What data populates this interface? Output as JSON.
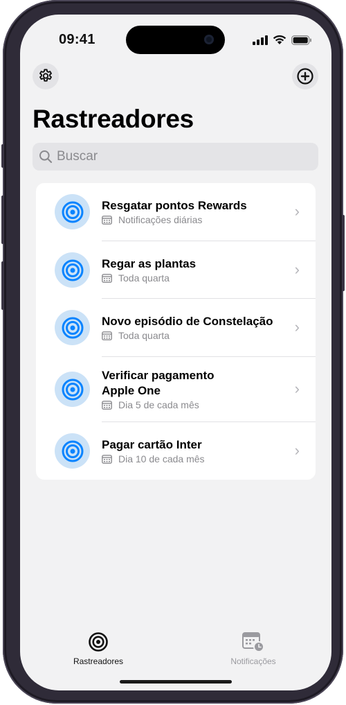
{
  "status_bar": {
    "time": "09:41"
  },
  "header": {
    "title": "Rastreadores"
  },
  "search": {
    "placeholder": "Buscar"
  },
  "colors": {
    "accent": "#0a84ff",
    "icon_bg": "#cbe2f7",
    "secondary_text": "#8a8a8e"
  },
  "trackers": [
    {
      "name": "Resgatar pontos Rewards",
      "schedule": "Notificações diárias"
    },
    {
      "name": "Regar as plantas",
      "schedule": "Toda quarta"
    },
    {
      "name": "Novo episódio de Constelação",
      "schedule": "Toda quarta"
    },
    {
      "name": "Verificar pagamento Apple One",
      "schedule": "Dia 5 de cada mês"
    },
    {
      "name": "Pagar cartão Inter",
      "schedule": "Dia 10 de cada mês"
    }
  ],
  "tabbar": {
    "tabs": [
      {
        "label": "Rastreadores",
        "icon": "target-icon",
        "active": true
      },
      {
        "label": "Notificações",
        "icon": "calendar-clock-icon",
        "active": false
      }
    ]
  }
}
